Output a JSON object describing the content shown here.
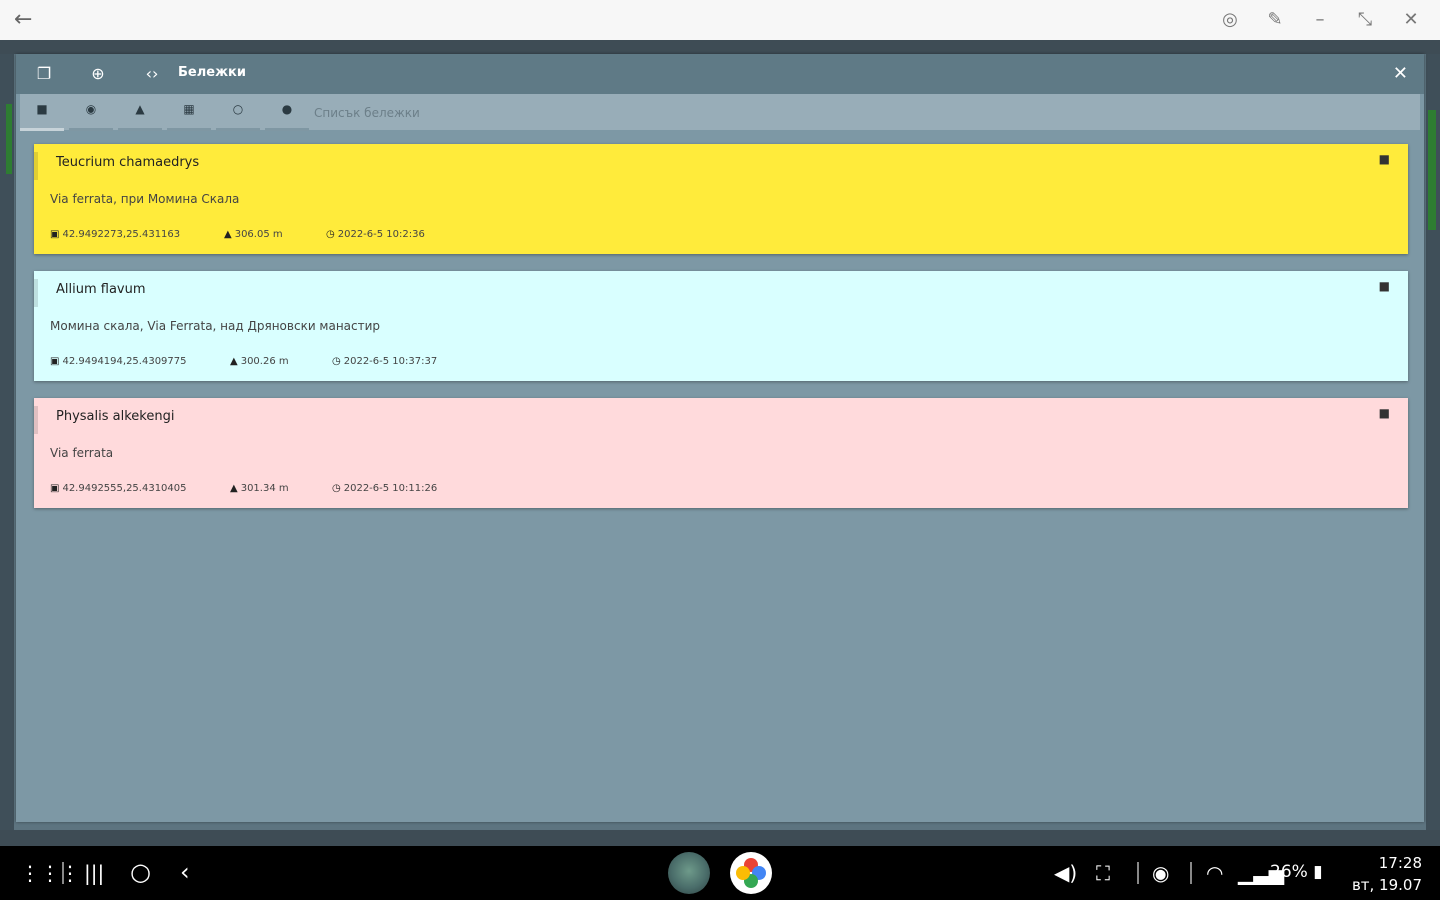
{
  "window": {
    "title": "Бележки"
  },
  "toolbar": {
    "search_placeholder": "Списък бележки"
  },
  "notes": [
    {
      "title": "Teucrium chamaedrys",
      "description": "Via ferrata, при Момина Скала",
      "coords": "42.9492273,25.431163",
      "altitude": "306.05 m",
      "datetime": "2022-6-5 10:2:36",
      "color": "#ffeb3b"
    },
    {
      "title": "Allium flavum",
      "description": "Момина скала, Via Ferrata, над Дряновски манастир",
      "coords": "42.9494194,25.4309775",
      "altitude": "300.26 m",
      "datetime": "2022-6-5 10:37:37",
      "color": "#d9ffff"
    },
    {
      "title": "Physalis alkekengi",
      "description": "Via ferrata",
      "coords": "42.9492555,25.4310405",
      "altitude": "301.34 m",
      "datetime": "2022-6-5 10:11:26",
      "color": "#ffdadc"
    }
  ],
  "statusbar": {
    "battery": "26%",
    "time": "17:28",
    "date": "вт, 19.07"
  },
  "colors": {
    "window_bg": "#7d98a5",
    "titlebar": "#5f7a86",
    "toolbar": "#98adb8"
  }
}
